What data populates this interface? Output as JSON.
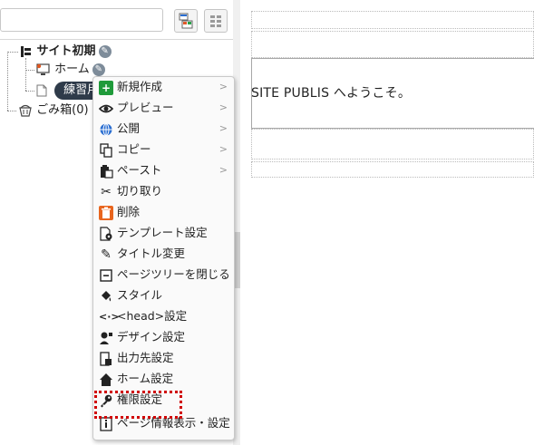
{
  "search": {
    "placeholder": ""
  },
  "tree": {
    "site_root": "サイト初期",
    "home": "ホーム",
    "practice_page": "練習用",
    "trash": "ごみ箱(0)"
  },
  "context_menu": {
    "items": [
      {
        "label": "新規作成",
        "icon": "plus-icon",
        "submenu": true
      },
      {
        "label": "プレビュー",
        "icon": "eye-icon",
        "submenu": true
      },
      {
        "label": "公開",
        "icon": "globe-icon",
        "submenu": true
      },
      {
        "label": "コピー",
        "icon": "copy-icon",
        "submenu": true
      },
      {
        "label": "ペースト",
        "icon": "clipboard-icon",
        "submenu": true
      },
      {
        "label": "切り取り",
        "icon": "scissors-icon",
        "submenu": false
      },
      {
        "label": "削除",
        "icon": "trash-icon",
        "submenu": false
      },
      {
        "label": "テンプレート設定",
        "icon": "template-icon",
        "submenu": false
      },
      {
        "label": "タイトル変更",
        "icon": "pencil-icon",
        "submenu": false
      },
      {
        "label": "ページツリーを閉じる",
        "icon": "collapse-icon",
        "submenu": false
      },
      {
        "label": "スタイル",
        "icon": "paint-bucket-icon",
        "submenu": false
      },
      {
        "label": "<head>設定",
        "icon": "code-icon",
        "submenu": false
      },
      {
        "label": "デザイン設定",
        "icon": "design-icon",
        "submenu": false
      },
      {
        "label": "出力先設定",
        "icon": "output-icon",
        "submenu": false
      },
      {
        "label": "ホーム設定",
        "icon": "home-icon",
        "submenu": false
      },
      {
        "label": "権限設定",
        "icon": "key-icon",
        "submenu": false
      },
      {
        "label": "ページ情報表示・設定",
        "icon": "info-icon",
        "submenu": false
      }
    ],
    "submenu_arrow": ">",
    "highlighted_item": "権限設定"
  },
  "content": {
    "welcome": "SITE PUBLIS へようこそ。"
  },
  "colors": {
    "highlight_border": "#d00000",
    "practice_badge_bg": "#2f3b4a",
    "plus_icon_bg": "#1f9a3a",
    "trash_icon_bg": "#e8651e",
    "globe_icon": "#2a6ed1"
  }
}
